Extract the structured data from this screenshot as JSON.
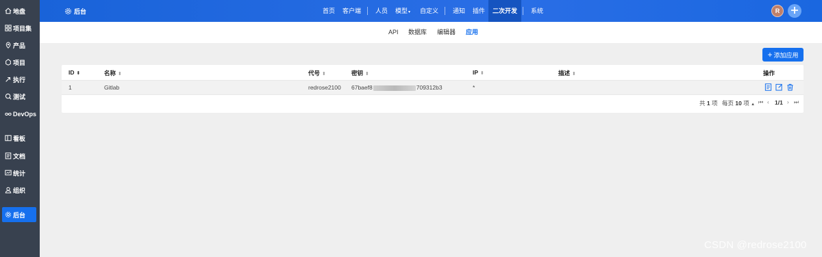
{
  "sidebar": {
    "items": [
      {
        "label": "地盘",
        "icon": "home-icon"
      },
      {
        "label": "项目集",
        "icon": "grid-icon"
      },
      {
        "label": "产品",
        "icon": "product-icon"
      },
      {
        "label": "项目",
        "icon": "project-icon"
      },
      {
        "label": "执行",
        "icon": "run-icon"
      },
      {
        "label": "测试",
        "icon": "test-icon"
      },
      {
        "label": "DevOps",
        "icon": "infinity-icon"
      },
      {
        "label": "看板",
        "icon": "board-icon"
      },
      {
        "label": "文档",
        "icon": "doc-icon"
      },
      {
        "label": "统计",
        "icon": "chart-icon"
      },
      {
        "label": "组织",
        "icon": "user-icon"
      },
      {
        "label": "后台",
        "icon": "gear-icon",
        "active": true
      }
    ]
  },
  "topbar": {
    "brand": "后台",
    "nav": [
      "首页",
      "客户端",
      "人员",
      "模型",
      "自定义",
      "通知",
      "插件",
      "二次开发",
      "系统"
    ],
    "active": "二次开发",
    "avatar_letter": "R"
  },
  "subnav": {
    "items": [
      "API",
      "数据库",
      "编辑器",
      "应用"
    ],
    "active": "应用"
  },
  "toolbar": {
    "add_label": "添加应用"
  },
  "table": {
    "columns": [
      "ID",
      "名称",
      "代号",
      "密钥",
      "IP",
      "描述",
      "操作"
    ],
    "rows": [
      {
        "id": "1",
        "name": "Gitlab",
        "code": "redrose2100",
        "key_start": "67baef8",
        "key_end": "709312b3",
        "ip": "*",
        "desc": ""
      }
    ]
  },
  "pager": {
    "total_prefix": "共",
    "total": "1",
    "total_suffix": "项",
    "per_page_prefix": "每页",
    "per_page": "10",
    "per_page_suffix": "项",
    "page": "1/1"
  },
  "watermark": "CSDN @redrose2100",
  "colors": {
    "sidebar_bg": "#38414f",
    "topbar_bg": "#2a6ee6",
    "accent": "#1670ee",
    "page_bg": "#efefef"
  }
}
